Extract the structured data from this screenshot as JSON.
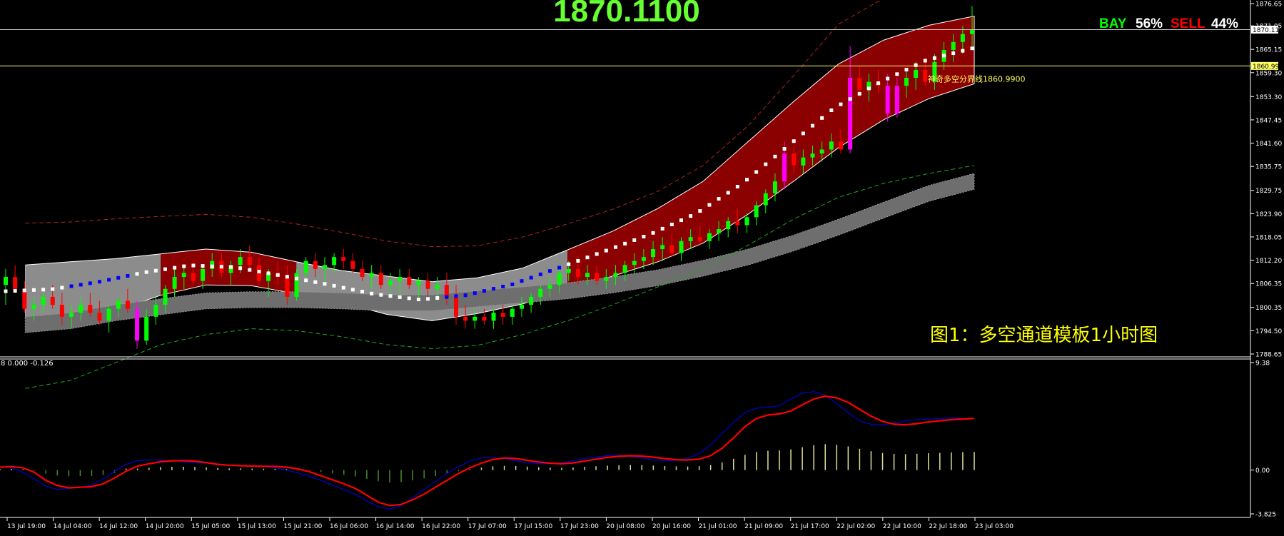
{
  "header": {
    "big_price": "1870.1100"
  },
  "sentiment": {
    "buy_label": "BAY",
    "buy_value": "56%",
    "sell_label": "SELL",
    "sell_value": "44%"
  },
  "caption": "图1：多空通道模板1小时图",
  "lines": {
    "current_price_tag": "1870.11",
    "boundary_tag": "1860.99",
    "boundary_label": "神奇多空分界线1860.9900"
  },
  "indicator": {
    "header_text": "8 0.000 -0.126"
  },
  "colors": {
    "background": "#000000",
    "up_candle": "#00ff00",
    "down_candle": "#ff0000",
    "strong_candle": "#ff00ff",
    "bull_channel": "#8b0000",
    "bear_channel": "#8c8c8c",
    "blue_line": "#0000ff",
    "red_line": "#ff0000",
    "green_text": "#00ff00",
    "sell_text": "#ff0000",
    "caption_text": "#ffff00"
  },
  "chart_data": [
    {
      "type": "candlestick",
      "title": "",
      "price_axis_ticks": [
        "1876.65",
        "1871.05",
        "1865.15",
        "1859.30",
        "1853.30",
        "1847.45",
        "1841.60",
        "1835.75",
        "1829.75",
        "1823.90",
        "1818.05",
        "1812.20",
        "1806.35",
        "1800.35",
        "1794.50",
        "1788.65"
      ],
      "ylim": [
        1788.65,
        1876.65
      ],
      "x_ticks": [
        "13 Jul 19:00",
        "14 Jul 04:00",
        "14 Jul 12:00",
        "14 Jul 20:00",
        "15 Jul 05:00",
        "15 Jul 13:00",
        "15 Jul 21:00",
        "16 Jul 06:00",
        "16 Jul 14:00",
        "16 Jul 22:00",
        "17 Jul 07:00",
        "17 Jul 15:00",
        "17 Jul 23:00",
        "20 Jul 08:00",
        "20 Jul 16:00",
        "21 Jul 01:00",
        "21 Jul 09:00",
        "21 Jul 17:00",
        "22 Jul 02:00",
        "22 Jul 10:00",
        "22 Jul 18:00",
        "23 Jul 03:00"
      ],
      "horizontal_lines": [
        {
          "value": 1870.11,
          "tag": "1870.11"
        },
        {
          "value": 1860.99,
          "tag": "1860.99",
          "label": "神奇多空分界线1860.9900"
        }
      ],
      "channel_sections": [
        {
          "from": "13 Jul 19:00",
          "to": "14 Jul 20:00",
          "trend": "bear"
        },
        {
          "from": "14 Jul 20:00",
          "to": "15 Jul 21:00",
          "trend": "bull"
        },
        {
          "from": "15 Jul 21:00",
          "to": "17 Jul 23:00",
          "trend": "bear"
        },
        {
          "from": "17 Jul 23:00",
          "to": "23 Jul 03:00",
          "trend": "bull"
        }
      ],
      "channel_mid": [
        1804.5,
        1805.0,
        1806.8,
        1809.2,
        1811.0,
        1810.5,
        1808.4,
        1806.2,
        1803.8,
        1802.4,
        1803.5,
        1806.2,
        1810.3,
        1814.5,
        1818.8,
        1824.0,
        1831.5,
        1841.0,
        1850.5,
        1857.0,
        1862.5,
        1865.5
      ],
      "channel_upper": [
        1811.0,
        1811.8,
        1812.6,
        1813.8,
        1815.0,
        1814.2,
        1811.8,
        1809.6,
        1808.2,
        1806.8,
        1807.8,
        1810.2,
        1814.8,
        1819.5,
        1825.2,
        1832.0,
        1842.0,
        1852.0,
        1861.5,
        1867.5,
        1871.2,
        1873.5
      ],
      "channel_lower": [
        1797.5,
        1797.8,
        1799.5,
        1803.4,
        1806.0,
        1805.8,
        1803.8,
        1801.6,
        1798.6,
        1797.0,
        1798.8,
        1801.2,
        1804.8,
        1808.2,
        1811.8,
        1816.5,
        1823.8,
        1832.0,
        1840.5,
        1847.5,
        1852.8,
        1856.5
      ],
      "outer_upper_dashed": [
        1821.5,
        1821.8,
        1822.6,
        1823.2,
        1823.7,
        1823.0,
        1821.3,
        1819.2,
        1817.0,
        1815.6,
        1815.8,
        1818.0,
        1821.3,
        1825.0,
        1829.5,
        1836.0,
        1846.0,
        1858.5,
        1871.5,
        1878.0,
        1878.0,
        1878.0
      ],
      "outer_lower_dashed": [
        1780.0,
        1782.0,
        1786.5,
        1791.0,
        1793.5,
        1795.0,
        1794.5,
        1793.0,
        1791.0,
        1790.0,
        1790.8,
        1793.5,
        1797.0,
        1801.0,
        1805.5,
        1810.0,
        1816.0,
        1822.5,
        1828.0,
        1831.5,
        1834.0,
        1836.0
      ],
      "slow_band": [
        1796.0,
        1797.0,
        1799.0,
        1800.5,
        1802.0,
        1802.3,
        1802.3,
        1802.0,
        1801.5,
        1801.5,
        1802.5,
        1803.5,
        1804.5,
        1806.0,
        1807.8,
        1810.2,
        1813.0,
        1816.5,
        1820.5,
        1824.8,
        1829.0,
        1832.0
      ],
      "ohlc": [
        [
          1806,
          1810,
          1801,
          1808
        ],
        [
          1808,
          1811,
          1804,
          1805
        ],
        [
          1805,
          1807,
          1799,
          1800
        ],
        [
          1800,
          1803,
          1797,
          1801
        ],
        [
          1801,
          1805,
          1799,
          1803
        ],
        [
          1803,
          1806,
          1800,
          1801
        ],
        [
          1801,
          1804,
          1796,
          1798
        ],
        [
          1798,
          1801,
          1795,
          1799
        ],
        [
          1799,
          1803,
          1797,
          1801
        ],
        [
          1801,
          1804,
          1798,
          1799
        ],
        [
          1799,
          1802,
          1796,
          1797
        ],
        [
          1797,
          1801,
          1794,
          1800
        ],
        [
          1800,
          1803,
          1798,
          1802
        ],
        [
          1802,
          1805,
          1799,
          1800
        ],
        [
          1800,
          1802,
          1790,
          1792
        ],
        [
          1792,
          1800,
          1791,
          1798
        ],
        [
          1798,
          1803,
          1796,
          1801
        ],
        [
          1801,
          1806,
          1799,
          1805
        ],
        [
          1805,
          1810,
          1803,
          1808
        ],
        [
          1808,
          1811,
          1805,
          1809
        ],
        [
          1809,
          1812,
          1806,
          1807
        ],
        [
          1807,
          1811,
          1805,
          1810
        ],
        [
          1810,
          1814,
          1808,
          1812
        ],
        [
          1812,
          1814,
          1808,
          1809
        ],
        [
          1809,
          1812,
          1806,
          1811
        ],
        [
          1811,
          1815,
          1809,
          1813
        ],
        [
          1813,
          1816,
          1810,
          1811
        ],
        [
          1811,
          1813,
          1806,
          1807
        ],
        [
          1807,
          1810,
          1803,
          1809
        ],
        [
          1809,
          1812,
          1806,
          1808
        ],
        [
          1808,
          1811,
          1801,
          1803
        ],
        [
          1803,
          1810,
          1802,
          1809
        ],
        [
          1809,
          1813,
          1807,
          1812
        ],
        [
          1812,
          1814,
          1808,
          1810
        ],
        [
          1810,
          1813,
          1807,
          1811
        ],
        [
          1811,
          1814,
          1809,
          1813
        ],
        [
          1813,
          1815,
          1810,
          1812
        ],
        [
          1812,
          1814,
          1809,
          1810
        ],
        [
          1810,
          1812,
          1807,
          1808
        ],
        [
          1808,
          1811,
          1805,
          1809
        ],
        [
          1809,
          1811,
          1805,
          1806
        ],
        [
          1806,
          1809,
          1803,
          1807
        ],
        [
          1807,
          1810,
          1804,
          1808
        ],
        [
          1808,
          1810,
          1805,
          1806
        ],
        [
          1806,
          1808,
          1803,
          1807
        ],
        [
          1807,
          1809,
          1803,
          1805
        ],
        [
          1805,
          1808,
          1802,
          1806
        ],
        [
          1806,
          1809,
          1801,
          1803
        ],
        [
          1803,
          1806,
          1796,
          1798
        ],
        [
          1798,
          1801,
          1795,
          1797
        ],
        [
          1797,
          1800,
          1795,
          1798
        ],
        [
          1798,
          1800,
          1796,
          1797
        ],
        [
          1797,
          1800,
          1795,
          1799
        ],
        [
          1799,
          1801,
          1796,
          1798
        ],
        [
          1798,
          1801,
          1796,
          1800
        ],
        [
          1800,
          1803,
          1798,
          1801
        ],
        [
          1801,
          1804,
          1799,
          1803
        ],
        [
          1803,
          1806,
          1801,
          1805
        ],
        [
          1805,
          1808,
          1803,
          1806
        ],
        [
          1806,
          1810,
          1804,
          1809
        ],
        [
          1809,
          1812,
          1807,
          1810
        ],
        [
          1810,
          1813,
          1806,
          1808
        ],
        [
          1808,
          1811,
          1806,
          1809
        ],
        [
          1809,
          1811,
          1806,
          1807
        ],
        [
          1807,
          1810,
          1805,
          1808
        ],
        [
          1808,
          1811,
          1806,
          1809
        ],
        [
          1809,
          1812,
          1807,
          1811
        ],
        [
          1811,
          1814,
          1809,
          1812
        ],
        [
          1812,
          1815,
          1810,
          1813
        ],
        [
          1813,
          1817,
          1811,
          1815
        ],
        [
          1815,
          1818,
          1812,
          1816
        ],
        [
          1816,
          1819,
          1813,
          1814
        ],
        [
          1814,
          1818,
          1812,
          1817
        ],
        [
          1817,
          1820,
          1815,
          1818
        ],
        [
          1818,
          1821,
          1816,
          1817
        ],
        [
          1817,
          1820,
          1815,
          1819
        ],
        [
          1819,
          1822,
          1817,
          1820
        ],
        [
          1820,
          1823,
          1818,
          1822
        ],
        [
          1822,
          1825,
          1819,
          1821
        ],
        [
          1821,
          1824,
          1819,
          1823
        ],
        [
          1823,
          1827,
          1821,
          1826
        ],
        [
          1826,
          1830,
          1824,
          1829
        ],
        [
          1829,
          1834,
          1827,
          1832
        ],
        [
          1832,
          1842,
          1830,
          1839
        ],
        [
          1839,
          1841,
          1834,
          1836
        ],
        [
          1836,
          1840,
          1834,
          1838
        ],
        [
          1838,
          1841,
          1836,
          1839
        ],
        [
          1839,
          1842,
          1837,
          1840
        ],
        [
          1840,
          1844,
          1838,
          1842
        ],
        [
          1842,
          1845,
          1839,
          1840
        ],
        [
          1840,
          1866,
          1839,
          1858
        ],
        [
          1858,
          1861,
          1853,
          1855
        ],
        [
          1855,
          1859,
          1852,
          1857
        ],
        [
          1857,
          1860,
          1854,
          1856
        ],
        [
          1856,
          1859,
          1847,
          1849
        ],
        [
          1849,
          1858,
          1848,
          1856
        ],
        [
          1856,
          1860,
          1853,
          1858
        ],
        [
          1858,
          1862,
          1855,
          1860
        ],
        [
          1860,
          1863,
          1856,
          1857
        ],
        [
          1857,
          1864,
          1855,
          1862
        ],
        [
          1862,
          1867,
          1860,
          1865
        ],
        [
          1865,
          1869,
          1862,
          1867
        ],
        [
          1867,
          1871,
          1864,
          1869
        ],
        [
          1869,
          1876,
          1866,
          1870
        ]
      ]
    },
    {
      "type": "macd",
      "title": "",
      "header_text": "8 0.000 -0.126",
      "y_ticks": [
        "9.38",
        "0.00",
        "-3.825"
      ],
      "ylim": [
        -3.825,
        9.38
      ],
      "series": [
        {
          "color": "red",
          "values": [
            0.25,
            0.3,
            0.2,
            -0.2,
            -0.9,
            -1.35,
            -1.55,
            -1.5,
            -1.45,
            -1.2,
            -0.7,
            -0.1,
            0.35,
            0.55,
            0.72,
            0.8,
            0.82,
            0.78,
            0.65,
            0.5,
            0.42,
            0.38,
            0.35,
            0.33,
            0.32,
            0.25,
            0.1,
            -0.15,
            -0.5,
            -0.85,
            -1.2,
            -1.6,
            -2.2,
            -2.8,
            -3.1,
            -3.0,
            -2.6,
            -2.1,
            -1.5,
            -0.9,
            -0.3,
            0.2,
            0.6,
            0.92,
            1.05,
            1.0,
            0.85,
            0.7,
            0.6,
            0.55,
            0.62,
            0.78,
            0.95,
            1.1,
            1.2,
            1.25,
            1.22,
            1.12,
            1.0,
            0.9,
            0.88,
            0.95,
            1.25,
            1.9,
            2.8,
            3.8,
            4.5,
            4.8,
            4.9,
            5.15,
            5.7,
            6.2,
            6.45,
            6.3,
            5.9,
            5.3,
            4.7,
            4.25,
            4.0,
            3.95,
            4.05,
            4.2,
            4.3,
            4.4,
            4.45,
            4.5
          ]
        },
        {
          "color": "blue",
          "values": [
            0.3,
            0.2,
            -0.2,
            -0.8,
            -1.4,
            -1.7,
            -1.6,
            -1.5,
            -1.3,
            -0.8,
            -0.1,
            0.5,
            0.8,
            0.9,
            0.85,
            0.8,
            0.72,
            0.68,
            0.6,
            0.5,
            0.45,
            0.4,
            0.38,
            0.3,
            0.2,
            0.0,
            -0.25,
            -0.55,
            -0.9,
            -1.3,
            -1.7,
            -2.1,
            -2.7,
            -3.2,
            -3.4,
            -3.1,
            -2.4,
            -1.7,
            -1.0,
            -0.3,
            0.3,
            0.8,
            1.05,
            1.1,
            1.0,
            0.8,
            0.65,
            0.55,
            0.55,
            0.62,
            0.8,
            1.0,
            1.15,
            1.25,
            1.3,
            1.2,
            1.05,
            0.9,
            0.8,
            0.85,
            1.0,
            1.45,
            2.2,
            3.2,
            4.2,
            5.0,
            5.4,
            5.5,
            5.6,
            6.2,
            6.7,
            6.85,
            6.5,
            5.8,
            5.0,
            4.3,
            4.0,
            3.95,
            4.1,
            4.3,
            4.4,
            4.45,
            4.5,
            4.55,
            4.5,
            4.45
          ]
        }
      ]
    }
  ]
}
